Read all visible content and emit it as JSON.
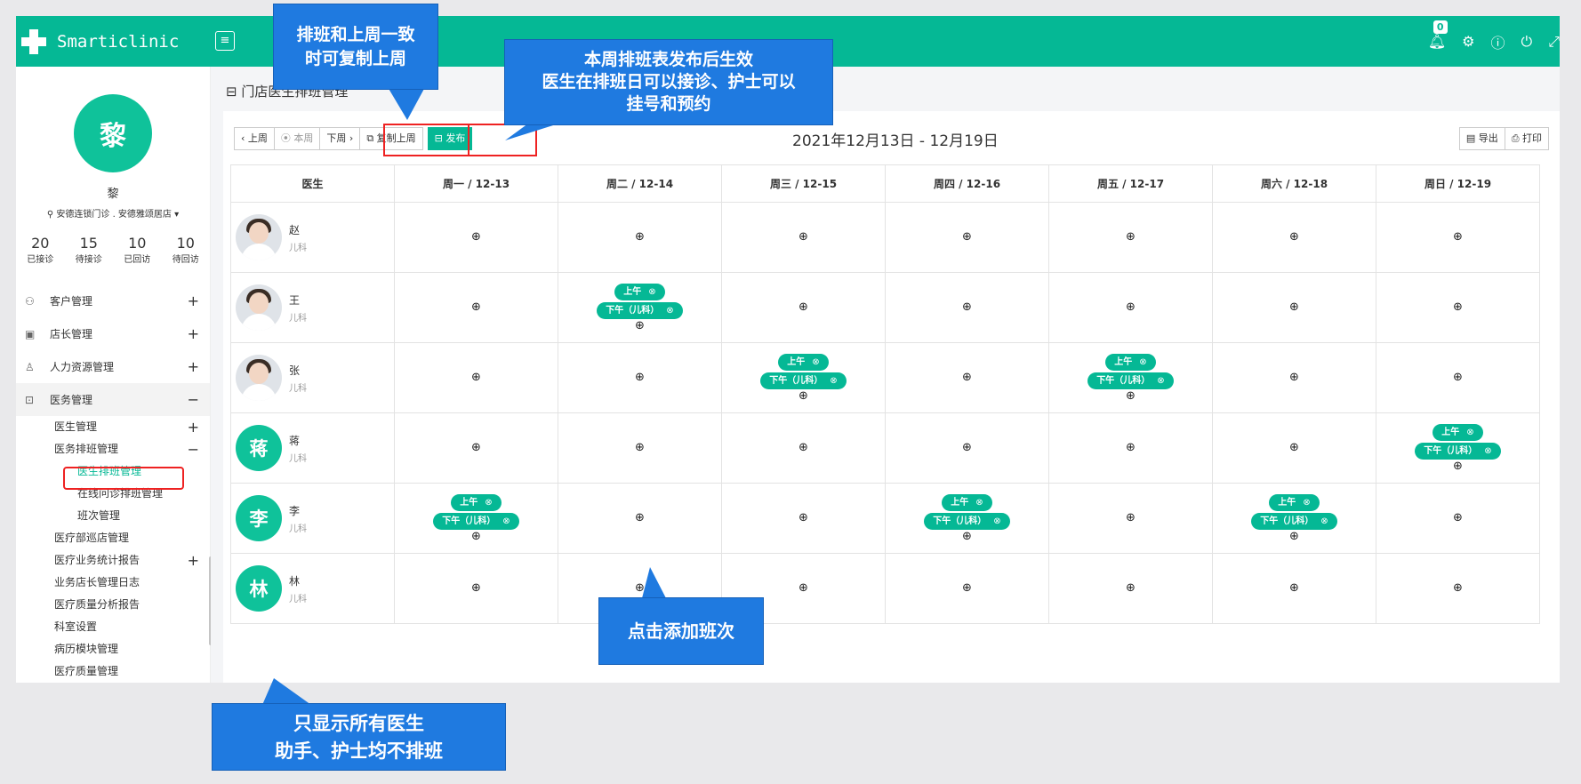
{
  "app": {
    "brand": "Smarticlinic",
    "badge_count": "0"
  },
  "icons": {
    "logo": "cross-logo-icon",
    "menu": "hamburger-icon",
    "bell": "bell-icon",
    "gear": "gear-icon",
    "help": "help-icon",
    "power": "power-icon",
    "location": "location-pin-icon"
  },
  "colors": {
    "primary": "#05b895",
    "callout": "#1f7ae0",
    "highlight": "#e22222"
  },
  "user": {
    "avatar_char": "黎",
    "name": "黎",
    "store": "安德连锁门诊 . 安德雅颂居店 ▾"
  },
  "stats": [
    {
      "value": "20",
      "label": "已接诊"
    },
    {
      "value": "15",
      "label": "待接诊"
    },
    {
      "value": "10",
      "label": "已回访"
    },
    {
      "value": "10",
      "label": "待回访"
    }
  ],
  "nav": {
    "customer": "客户管理",
    "manager": "店长管理",
    "hr": "人力资源管理",
    "medical": "医务管理",
    "doctor_mgmt": "医生管理",
    "schedule_mgmt": "医务排班管理",
    "doctor_schedule": "医生排班管理",
    "online_schedule": "在线问诊排班管理",
    "shift_mgmt": "班次管理",
    "patrol": "医疗部巡店管理",
    "stats_report": "医疗业务统计报告",
    "manager_log": "业务店长管理日志",
    "quality_report": "医疗质量分析报告",
    "dept_setting": "科室设置",
    "records_module": "病历模块管理",
    "quality_mgmt": "医疗质量管理"
  },
  "page": {
    "title": "门店医生排班管理",
    "week_range": "2021年12月13日 - 12月19日"
  },
  "toolbar": {
    "prev": "‹ 上周",
    "this_week": "⦿ 本周",
    "next": "下周 ›",
    "copy": "复制上周",
    "publish": "发布",
    "export": "导出",
    "print": "打印"
  },
  "table": {
    "doctor_header": "医生",
    "days": [
      "周一 / 12-13",
      "周二 / 12-14",
      "周三 / 12-15",
      "周四 / 12-16",
      "周五 / 12-17",
      "周六 / 12-18",
      "周日 / 12-19"
    ],
    "doctors": [
      {
        "name": "赵",
        "dept": "儿科",
        "avatar": "photo",
        "avatar_char": ""
      },
      {
        "name": "王",
        "dept": "儿科",
        "avatar": "photo",
        "avatar_char": ""
      },
      {
        "name": "张",
        "dept": "儿科",
        "avatar": "photo",
        "avatar_char": ""
      },
      {
        "name": "蒋",
        "dept": "儿科",
        "avatar": "char",
        "avatar_char": "蒋"
      },
      {
        "name": "李",
        "dept": "儿科",
        "avatar": "char",
        "avatar_char": "李"
      },
      {
        "name": "林",
        "dept": "儿科",
        "avatar": "char",
        "avatar_char": "林"
      }
    ],
    "shift_am": "上午",
    "shift_pm": "下午（儿科）",
    "add_symbol": "⊕",
    "remove_symbol": "⊗",
    "schedule": [
      [
        [],
        [],
        [],
        [],
        [],
        [],
        []
      ],
      [
        [],
        [
          "am",
          "pm"
        ],
        [],
        [],
        [],
        [],
        []
      ],
      [
        [],
        [],
        [
          "am",
          "pm"
        ],
        [],
        [
          "am",
          "pm"
        ],
        [],
        []
      ],
      [
        [],
        [],
        [],
        [],
        [],
        [],
        [
          "am",
          "pm"
        ]
      ],
      [
        [
          "am",
          "pm"
        ],
        [],
        [],
        [
          "am",
          "pm"
        ],
        [],
        [
          "am",
          "pm"
        ],
        []
      ],
      [
        [],
        [],
        [],
        [],
        [],
        [],
        []
      ]
    ]
  },
  "callouts": {
    "copy_tip": "排班和上周一致\n时可复制上周",
    "publish_tip": "本周排班表发布后生效\n医生在排班日可以接诊、护士可以\n挂号和预约",
    "add_tip": "点击添加班次",
    "doctor_tip": "只显示所有医生\n助手、护士均不排班"
  }
}
